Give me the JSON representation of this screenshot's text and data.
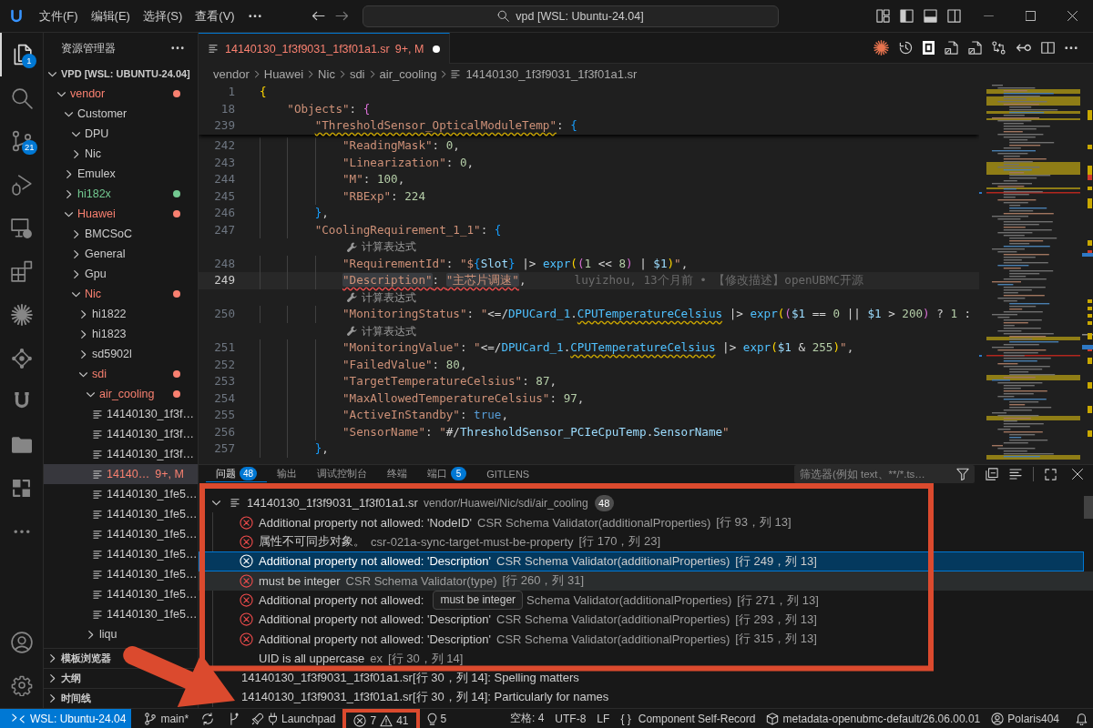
{
  "title_bar": {
    "menus": [
      "文件(F)",
      "编辑(E)",
      "选择(S)",
      "查看(V)"
    ],
    "search": {
      "value": "vpd [WSL: Ubuntu-24.04]"
    }
  },
  "activity_bar": {
    "items": [
      {
        "kind": "explorer",
        "badge": "1",
        "selected": true
      },
      {
        "kind": "search",
        "selected": false
      },
      {
        "kind": "source-control",
        "badge": "21",
        "selected": false
      },
      {
        "kind": "run-debug",
        "selected": false
      },
      {
        "kind": "remote",
        "selected": false
      },
      {
        "kind": "extensions",
        "selected": false
      },
      {
        "kind": "sparkle",
        "selected": false
      },
      {
        "kind": "graph",
        "selected": false
      },
      {
        "kind": "magnet",
        "selected": false
      },
      {
        "kind": "folder",
        "selected": false
      },
      {
        "kind": "blocks",
        "selected": false
      },
      {
        "kind": "more",
        "selected": false
      }
    ],
    "bottom": [
      {
        "kind": "account"
      },
      {
        "kind": "settings"
      }
    ]
  },
  "sidebar": {
    "title": "资源管理器",
    "root": {
      "label": "VPD [WSL: UBUNTU-24.04]",
      "expanded": true,
      "children": [
        {
          "label": "vendor",
          "kind": "folder",
          "expanded": true,
          "color": "#f88070",
          "selected": false,
          "children": [
            {
              "label": "Customer",
              "kind": "folder",
              "expanded": true,
              "selected": false,
              "children": [
                {
                  "label": "DPU",
                  "kind": "folder",
                  "expanded": true,
                  "selected": false
                },
                {
                  "label": "Nic",
                  "kind": "folder",
                  "expanded": false,
                  "selected": false
                }
              ]
            },
            {
              "label": "Emulex",
              "kind": "folder",
              "expanded": false,
              "selected": false
            },
            {
              "label": "hi182x",
              "kind": "folder",
              "expanded": false,
              "color": "#73c991",
              "selected": false
            },
            {
              "label": "Huawei",
              "kind": "folder",
              "expanded": true,
              "color": "#f88070",
              "selected": false,
              "children": [
                {
                  "label": "BMCSoC",
                  "kind": "folder",
                  "expanded": false,
                  "selected": false
                },
                {
                  "label": "General",
                  "kind": "folder",
                  "expanded": false,
                  "selected": false
                },
                {
                  "label": "Gpu",
                  "kind": "folder",
                  "expanded": false,
                  "selected": false
                },
                {
                  "label": "Nic",
                  "kind": "folder",
                  "expanded": true,
                  "color": "#f88070",
                  "selected": false,
                  "children": [
                    {
                      "label": "hi1822",
                      "kind": "folder",
                      "expanded": false,
                      "selected": false
                    },
                    {
                      "label": "hi1823",
                      "kind": "folder",
                      "expanded": false,
                      "selected": false
                    },
                    {
                      "label": "sd5902l",
                      "kind": "folder",
                      "expanded": false,
                      "selected": false
                    },
                    {
                      "label": "sdi",
                      "kind": "folder",
                      "expanded": true,
                      "color": "#f88070",
                      "selected": false,
                      "children": [
                        {
                          "label": "air_cooling",
                          "kind": "folder",
                          "expanded": true,
                          "color": "#f88070",
                          "selected": false,
                          "children": [
                            {
                              "label": "14140130_1f3f…",
                              "kind": "file",
                              "selected": false
                            },
                            {
                              "label": "14140130_1f3f…",
                              "kind": "file",
                              "selected": false
                            },
                            {
                              "label": "14140130_1f3f…",
                              "kind": "file",
                              "selected": false
                            },
                            {
                              "label": "14140…",
                              "kind": "file",
                              "color": "#f88070",
                              "badge": "9+, M",
                              "selected": true
                            },
                            {
                              "label": "14140130_1fe5…",
                              "kind": "file",
                              "selected": false
                            },
                            {
                              "label": "14140130_1fe5…",
                              "kind": "file",
                              "selected": false
                            },
                            {
                              "label": "14140130_1fe5…",
                              "kind": "file",
                              "selected": false
                            },
                            {
                              "label": "14140130_1fe5…",
                              "kind": "file",
                              "selected": false
                            },
                            {
                              "label": "14140130_1fe5…",
                              "kind": "file",
                              "selected": false
                            },
                            {
                              "label": "14140130_1fe5…",
                              "kind": "file",
                              "selected": false
                            },
                            {
                              "label": "14140130_1fe5…",
                              "kind": "file",
                              "selected": false
                            }
                          ]
                        },
                        {
                          "label": "liqu",
                          "kind": "folder",
                          "expanded": false,
                          "selected": false
                        }
                      ]
                    }
                  ]
                }
              ]
            }
          ]
        }
      ]
    },
    "sections": [
      {
        "label": "模板浏览器",
        "expanded": false
      },
      {
        "label": "大纲",
        "expanded": false
      },
      {
        "label": "时间线",
        "expanded": false
      }
    ]
  },
  "editor": {
    "tabs": [
      {
        "label": "14140130_1f3f9031_1f3f01a1.sr",
        "badge": "9+, M",
        "errors": true,
        "dirty": true,
        "selected": true
      }
    ],
    "breadcrumb": [
      {
        "label": "vendor",
        "kind": "folder"
      },
      {
        "label": "Huawei",
        "kind": "folder"
      },
      {
        "label": "Nic",
        "kind": "folder"
      },
      {
        "label": "sdi",
        "kind": "folder"
      },
      {
        "label": "air_cooling",
        "kind": "folder"
      },
      {
        "label": "14140130_1f3f9031_1f3f01a1.sr",
        "kind": "file"
      }
    ],
    "sticky_lines": [
      {
        "kind": "code",
        "number": "1",
        "current": false,
        "tokens": [
          {
            "text": "{",
            "kind": "open"
          }
        ]
      },
      {
        "kind": "code",
        "number": "18",
        "current": false,
        "tokens": [
          {
            "text": "\"Objects\"",
            "kind": "str"
          },
          {
            "text": ": ",
            "kind": "punc"
          },
          {
            "text": "{",
            "kind": "open"
          }
        ]
      },
      {
        "kind": "code",
        "number": "239",
        "current": false,
        "tokens": [
          {
            "text": "\"ThresholdSensor_OpticalModuleTemp\"",
            "kind": "str",
            "warning": true
          },
          {
            "text": ": ",
            "kind": "punc"
          },
          {
            "text": "{",
            "kind": "open"
          }
        ]
      }
    ],
    "lines": [
      {
        "kind": "code",
        "number": "242",
        "current": false,
        "tokens": [
          {
            "text": "\"ReadingMask\"",
            "kind": "str"
          },
          {
            "text": ": ",
            "kind": "punc"
          },
          {
            "text": "0",
            "kind": "num"
          },
          {
            "text": ",",
            "kind": "punc"
          }
        ]
      },
      {
        "kind": "code",
        "number": "243",
        "current": false,
        "tokens": [
          {
            "text": "\"Linearization\"",
            "kind": "str"
          },
          {
            "text": ": ",
            "kind": "punc"
          },
          {
            "text": "0",
            "kind": "num"
          },
          {
            "text": ",",
            "kind": "punc"
          }
        ]
      },
      {
        "kind": "code",
        "number": "244",
        "current": false,
        "tokens": [
          {
            "text": "\"M\"",
            "kind": "str"
          },
          {
            "text": ": ",
            "kind": "punc"
          },
          {
            "text": "100",
            "kind": "num"
          },
          {
            "text": ",",
            "kind": "punc"
          }
        ]
      },
      {
        "kind": "code",
        "number": "245",
        "current": false,
        "tokens": [
          {
            "text": "\"RBExp\"",
            "kind": "str"
          },
          {
            "text": ": ",
            "kind": "punc"
          },
          {
            "text": "224",
            "kind": "num"
          }
        ]
      },
      {
        "kind": "code",
        "number": "246",
        "current": false,
        "tokens": [
          {
            "text": "}",
            "kind": "close"
          },
          {
            "text": ",",
            "kind": "punc"
          }
        ]
      },
      {
        "kind": "code",
        "number": "247",
        "current": false,
        "tokens": [
          {
            "text": "\"CoolingRequirement_1_1\"",
            "kind": "str"
          },
          {
            "text": ": ",
            "kind": "punc"
          },
          {
            "text": "{",
            "kind": "open"
          }
        ]
      },
      {
        "kind": "codelens",
        "text": "计算表达式"
      },
      {
        "kind": "code",
        "number": "248",
        "current": false,
        "tokens": [
          {
            "text": "\"RequirementId\"",
            "kind": "str"
          },
          {
            "text": ": ",
            "kind": "punc"
          },
          {
            "text": "\"$",
            "kind": "str"
          },
          {
            "text": "{",
            "kind": "interp"
          },
          {
            "text": "Slot",
            "kind": "var"
          },
          {
            "text": "}",
            "kind": "interp"
          },
          {
            "text": " |> ",
            "kind": "op"
          },
          {
            "text": "expr",
            "kind": "ref"
          },
          {
            "text": "(",
            "kind": "popen"
          },
          {
            "text": "(",
            "kind": "popen"
          },
          {
            "text": "1",
            "kind": "num"
          },
          {
            "text": " << ",
            "kind": "op"
          },
          {
            "text": "8",
            "kind": "num"
          },
          {
            "text": ")",
            "kind": "pclose"
          },
          {
            "text": " | ",
            "kind": "op"
          },
          {
            "text": "$1",
            "kind": "var"
          },
          {
            "text": ")",
            "kind": "pclose"
          },
          {
            "text": "\"",
            "kind": "str"
          },
          {
            "text": ",",
            "kind": "punc"
          }
        ]
      },
      {
        "kind": "code",
        "number": "249",
        "current": true,
        "tokens": [
          {
            "text": "\"Description\"",
            "kind": "str",
            "error": true,
            "highlight": true
          },
          {
            "text": ": ",
            "kind": "punc",
            "error": true
          },
          {
            "text": "\"主芯片调速\"",
            "kind": "str",
            "error": true,
            "highlight": true
          },
          {
            "text": ",",
            "kind": "punc"
          }
        ],
        "blame": "luyizhou, 13个月前 • 【修改描述】openUBMC开源"
      },
      {
        "kind": "codelens",
        "text": "计算表达式"
      },
      {
        "kind": "code",
        "number": "250",
        "current": false,
        "tokens": [
          {
            "text": "\"MonitoringStatus\"",
            "kind": "str"
          },
          {
            "text": ": ",
            "kind": "punc"
          },
          {
            "text": "\"",
            "kind": "str"
          },
          {
            "text": "<=/",
            "kind": "op"
          },
          {
            "text": "DPUCard_1",
            "kind": "ref"
          },
          {
            "text": ".",
            "kind": "op"
          },
          {
            "text": "CPUTemperatureCelsius",
            "kind": "ref",
            "warning": true
          },
          {
            "text": " |> ",
            "kind": "op"
          },
          {
            "text": "expr",
            "kind": "ref"
          },
          {
            "text": "(",
            "kind": "popen"
          },
          {
            "text": "(",
            "kind": "popen"
          },
          {
            "text": "$1",
            "kind": "var"
          },
          {
            "text": " == ",
            "kind": "op"
          },
          {
            "text": "0",
            "kind": "num"
          },
          {
            "text": " || ",
            "kind": "op"
          },
          {
            "text": "$1",
            "kind": "var"
          },
          {
            "text": " > ",
            "kind": "op"
          },
          {
            "text": "200",
            "kind": "num"
          },
          {
            "text": ")",
            "kind": "pclose"
          },
          {
            "text": " ? ",
            "kind": "op"
          },
          {
            "text": "1",
            "kind": "num"
          },
          {
            "text": " :",
            "kind": "op"
          }
        ]
      },
      {
        "kind": "codelens",
        "text": "计算表达式"
      },
      {
        "kind": "code",
        "number": "251",
        "current": false,
        "tokens": [
          {
            "text": "\"MonitoringValue\"",
            "kind": "str"
          },
          {
            "text": ": ",
            "kind": "punc"
          },
          {
            "text": "\"",
            "kind": "str"
          },
          {
            "text": "<=/",
            "kind": "op"
          },
          {
            "text": "DPUCard_1",
            "kind": "ref"
          },
          {
            "text": ".",
            "kind": "op"
          },
          {
            "text": "CPUTemperatureCelsius",
            "kind": "ref",
            "warning": true
          },
          {
            "text": " |> ",
            "kind": "op"
          },
          {
            "text": "expr",
            "kind": "ref"
          },
          {
            "text": "(",
            "kind": "popen"
          },
          {
            "text": "$1",
            "kind": "var"
          },
          {
            "text": " & ",
            "kind": "op"
          },
          {
            "text": "255",
            "kind": "num"
          },
          {
            "text": ")",
            "kind": "pclose"
          },
          {
            "text": "\"",
            "kind": "str"
          },
          {
            "text": ",",
            "kind": "punc"
          }
        ]
      },
      {
        "kind": "code",
        "number": "252",
        "current": false,
        "tokens": [
          {
            "text": "\"FailedValue\"",
            "kind": "str"
          },
          {
            "text": ": ",
            "kind": "punc"
          },
          {
            "text": "80",
            "kind": "num"
          },
          {
            "text": ",",
            "kind": "punc"
          }
        ]
      },
      {
        "kind": "code",
        "number": "253",
        "current": false,
        "tokens": [
          {
            "text": "\"TargetTemperatureCelsius\"",
            "kind": "str"
          },
          {
            "text": ": ",
            "kind": "punc"
          },
          {
            "text": "87",
            "kind": "num"
          },
          {
            "text": ",",
            "kind": "punc"
          }
        ]
      },
      {
        "kind": "code",
        "number": "254",
        "current": false,
        "tokens": [
          {
            "text": "\"MaxAllowedTemperatureCelsius\"",
            "kind": "str"
          },
          {
            "text": ": ",
            "kind": "punc"
          },
          {
            "text": "97",
            "kind": "num"
          },
          {
            "text": ",",
            "kind": "punc"
          }
        ]
      },
      {
        "kind": "code",
        "number": "255",
        "current": false,
        "tokens": [
          {
            "text": "\"ActiveInStandby\"",
            "kind": "str"
          },
          {
            "text": ": ",
            "kind": "punc"
          },
          {
            "text": "true",
            "kind": "kw"
          },
          {
            "text": ",",
            "kind": "punc"
          }
        ]
      },
      {
        "kind": "code",
        "number": "256",
        "current": false,
        "tokens": [
          {
            "text": "\"SensorName\"",
            "kind": "str"
          },
          {
            "text": ": ",
            "kind": "punc"
          },
          {
            "text": "\"",
            "kind": "str"
          },
          {
            "text": "#/",
            "kind": "op"
          },
          {
            "text": "ThresholdSensor_PCIeCpuTemp",
            "kind": "var"
          },
          {
            "text": ".",
            "kind": "op"
          },
          {
            "text": "SensorName",
            "kind": "var"
          },
          {
            "text": "\"",
            "kind": "str"
          }
        ]
      },
      {
        "kind": "code",
        "number": "257",
        "current": false,
        "tokens": [
          {
            "text": "}",
            "kind": "close"
          },
          {
            "text": ",",
            "kind": "punc"
          }
        ]
      }
    ]
  },
  "panel": {
    "tabs": [
      {
        "label": "问题",
        "badge": "48",
        "selected": true
      },
      {
        "label": "输出",
        "selected": false
      },
      {
        "label": "调试控制台",
        "selected": false
      },
      {
        "label": "终端",
        "selected": false
      },
      {
        "label": "端口",
        "badge": "5",
        "selected": false
      },
      {
        "label": "GITLENS",
        "selected": false
      }
    ],
    "filter": {
      "placeholder": "筛选器(例如 text、**/*.ts…"
    },
    "problems": {
      "file": "14140130_1f3f9031_1f3f01a1.sr",
      "path": "vendor/Huawei/Nic/sdi/air_cooling",
      "count": "48",
      "expanded": true,
      "items": [
        {
          "kind": "error",
          "message": "Additional property not allowed: 'NodeID'",
          "source": "CSR Schema Validator(additionalProperties)",
          "location": "[行 93，列 13]",
          "selected": false,
          "hovered": false
        },
        {
          "kind": "error",
          "message": "属性不可同步对象。",
          "source": "csr-021a-sync-target-must-be-property",
          "location": "[行 170，列 23]",
          "selected": false,
          "hovered": false
        },
        {
          "kind": "error",
          "message": "Additional property not allowed: 'Description'",
          "source": "CSR Schema Validator(additionalProperties)",
          "location": "[行 249，列 13]",
          "selected": true,
          "hovered": false
        },
        {
          "kind": "error",
          "message": "must be integer",
          "source": "CSR Schema Validator(type)",
          "location": "[行 260，列 31]",
          "selected": false,
          "hovered": true
        },
        {
          "kind": "error",
          "message": "Additional property not allowed:",
          "tooltip": "must be integer",
          "source": "Schema Validator(additionalProperties)",
          "location": "[行 271，列 13]",
          "selected": false,
          "hovered": false
        },
        {
          "kind": "error",
          "message": "Additional property not allowed: 'Description'",
          "source": "CSR Schema Validator(additionalProperties)",
          "location": "[行 293，列 13]",
          "selected": false,
          "hovered": false
        },
        {
          "kind": "error",
          "message": "Additional property not allowed: 'Description'",
          "source": "CSR Schema Validator(additionalProperties)",
          "location": "[行 315，列 13]",
          "selected": false,
          "hovered": false
        },
        {
          "kind": "plain",
          "message": "UID is all uppercase",
          "source": "ex",
          "location": "[行 30，列 14]",
          "selected": false,
          "hovered": false
        },
        {
          "kind": "related",
          "text": "14140130_1f3f9031_1f3f01a1.sr[行 30，列 14]: Spelling matters",
          "selected": false,
          "hovered": false
        },
        {
          "kind": "related",
          "text": "14140130_1f3f9031_1f3f01a1.sr[行 30，列 14]: Particularly for names",
          "selected": false,
          "hovered": false
        }
      ]
    }
  },
  "status_bar": {
    "remote": "WSL: Ubuntu-24.04",
    "left": [
      {
        "kind": "branch",
        "text": "main*"
      },
      {
        "kind": "sync"
      },
      {
        "kind": "graph"
      },
      {
        "kind": "launchpad",
        "text": "Launchpad"
      },
      {
        "kind": "problems",
        "errors": "7",
        "warnings": "41"
      },
      {
        "kind": "ports",
        "text": "5"
      }
    ],
    "right": [
      {
        "kind": "plain",
        "text": "空格: 4"
      },
      {
        "kind": "plain",
        "text": "UTF-8"
      },
      {
        "kind": "plain",
        "text": "LF"
      },
      {
        "kind": "language",
        "symbol": "{ }",
        "text": "Component Self-Record"
      },
      {
        "kind": "cube",
        "text": "metadata-openubmc-default/26.06.00.01"
      },
      {
        "kind": "account",
        "text": "Polaris404"
      },
      {
        "kind": "bell"
      }
    ]
  }
}
